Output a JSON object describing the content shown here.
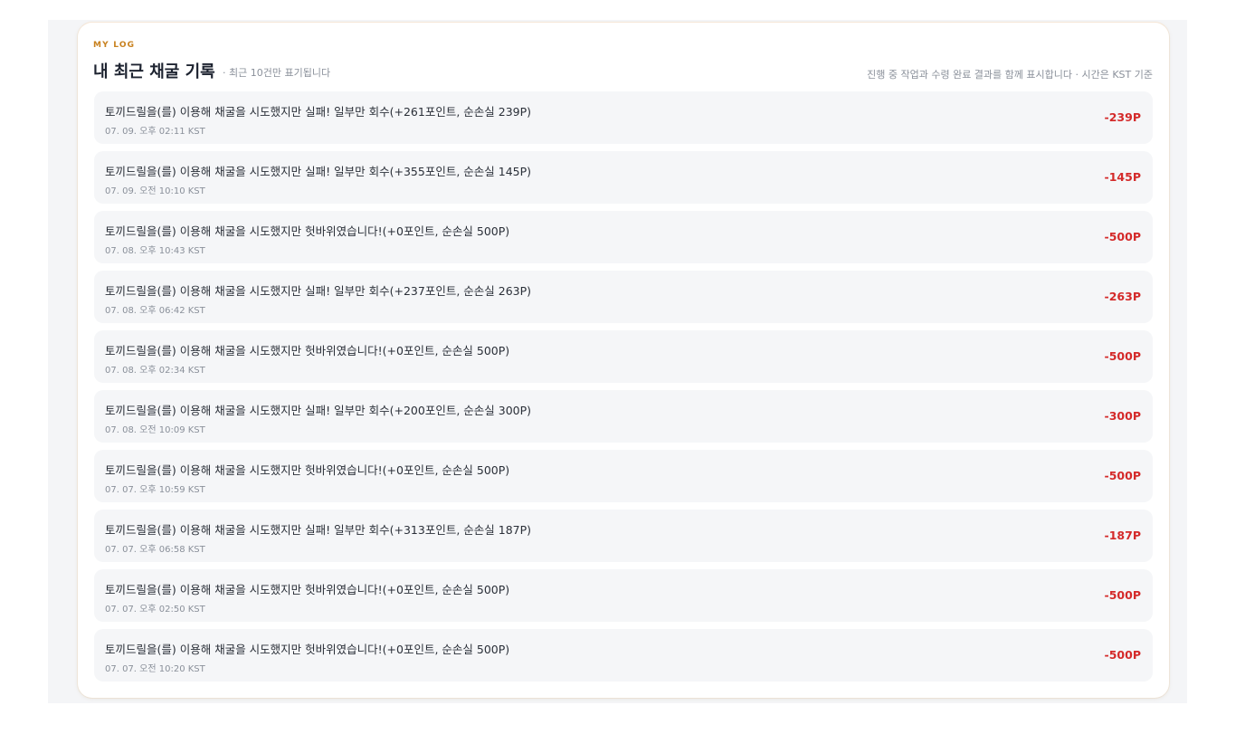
{
  "header": {
    "eyebrow": "MY LOG",
    "title": "내 최근 채굴 기록",
    "subtitle": "· 최근 10건만 표기됩니다",
    "note": "진행 중 작업과 수령 완료 결과를 함께 표시합니다 · 시간은 KST 기준"
  },
  "log": [
    {
      "message": "토끼드릴을(를) 이용해 채굴을 시도했지만 실패! 일부만 회수(+261포인트, 순손실 239P)",
      "time": "07. 09. 오후 02:11 KST",
      "amount": "-239P"
    },
    {
      "message": "토끼드릴을(를) 이용해 채굴을 시도했지만 실패! 일부만 회수(+355포인트, 순손실 145P)",
      "time": "07. 09. 오전 10:10 KST",
      "amount": "-145P"
    },
    {
      "message": "토끼드릴을(를) 이용해 채굴을 시도했지만 헛바위였습니다!(+0포인트, 순손실 500P)",
      "time": "07. 08. 오후 10:43 KST",
      "amount": "-500P"
    },
    {
      "message": "토끼드릴을(를) 이용해 채굴을 시도했지만 실패! 일부만 회수(+237포인트, 순손실 263P)",
      "time": "07. 08. 오후 06:42 KST",
      "amount": "-263P"
    },
    {
      "message": "토끼드릴을(를) 이용해 채굴을 시도했지만 헛바위였습니다!(+0포인트, 순손실 500P)",
      "time": "07. 08. 오후 02:34 KST",
      "amount": "-500P"
    },
    {
      "message": "토끼드릴을(를) 이용해 채굴을 시도했지만 실패! 일부만 회수(+200포인트, 순손실 300P)",
      "time": "07. 08. 오전 10:09 KST",
      "amount": "-300P"
    },
    {
      "message": "토끼드릴을(를) 이용해 채굴을 시도했지만 헛바위였습니다!(+0포인트, 순손실 500P)",
      "time": "07. 07. 오후 10:59 KST",
      "amount": "-500P"
    },
    {
      "message": "토끼드릴을(를) 이용해 채굴을 시도했지만 실패! 일부만 회수(+313포인트, 순손실 187P)",
      "time": "07. 07. 오후 06:58 KST",
      "amount": "-187P"
    },
    {
      "message": "토끼드릴을(를) 이용해 채굴을 시도했지만 헛바위였습니다!(+0포인트, 순손실 500P)",
      "time": "07. 07. 오후 02:50 KST",
      "amount": "-500P"
    },
    {
      "message": "토끼드릴을(를) 이용해 채굴을 시도했지만 헛바위였습니다!(+0포인트, 순손실 500P)",
      "time": "07. 07. 오전 10:20 KST",
      "amount": "-500P"
    }
  ],
  "colors": {
    "accent": "#c8811e",
    "loss": "#d42a2a",
    "row_background": "#f5f6f8"
  }
}
